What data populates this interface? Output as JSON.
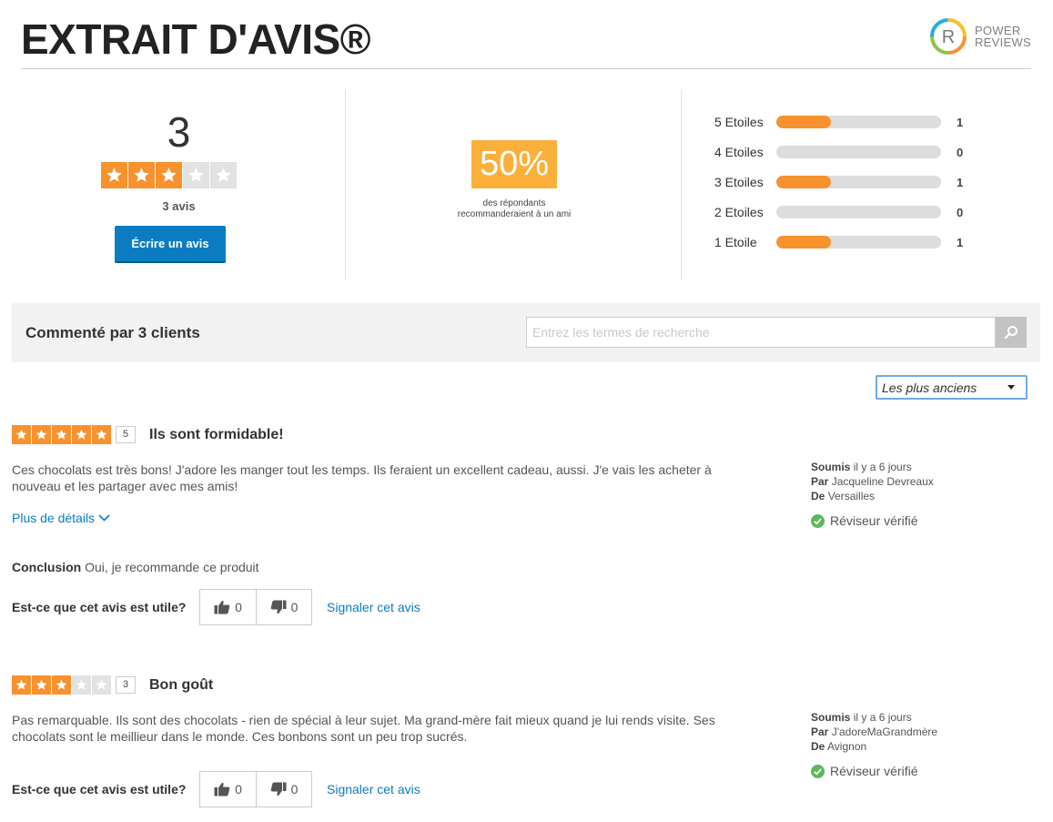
{
  "header": {
    "title": "EXTRAIT D'AVIS®",
    "logo_text_line1": "POWER",
    "logo_text_line2": "REVIEWS"
  },
  "snapshot": {
    "average_rating": "3",
    "average_stars": 3,
    "review_count": "3 avis",
    "write_button": "Écrire un avis",
    "recommend_percent": "50%",
    "recommend_text_line1": "des répondants",
    "recommend_text_line2": "recommanderaient à un ami",
    "histogram": [
      {
        "label": "5 Etoiles",
        "count": "1",
        "fraction": 0.33
      },
      {
        "label": "4 Etoiles",
        "count": "0",
        "fraction": 0
      },
      {
        "label": "3 Etoiles",
        "count": "1",
        "fraction": 0.33
      },
      {
        "label": "2 Etoiles",
        "count": "0",
        "fraction": 0
      },
      {
        "label": "1 Etoile",
        "count": "1",
        "fraction": 0.33
      }
    ]
  },
  "toolbar": {
    "title": "Commenté par 3 clients",
    "search_placeholder": "Entrez les termes de recherche",
    "sort_value": "Les plus anciens"
  },
  "reviews": [
    {
      "rating": 5,
      "rating_label": "5",
      "title": "Ils sont formidable!",
      "body_line1": "Ces chocolats est très bons! J'adore les manger tout les temps. Ils feraient un excellent cadeau, aussi. J'e vais les acheter à",
      "body_line2": "nouveau et les partager avec mes amis!",
      "details_link": "Plus de détails",
      "conclusion_label": "Conclusion",
      "conclusion_text": "Oui, je recommande ce produit",
      "helpful_question": "Est-ce que cet avis est utile?",
      "helpful_yes": "0",
      "helpful_no": "0",
      "flag_link": "Signaler cet avis",
      "submitted_label": "Soumis",
      "submitted_value": "il y a 6 jours",
      "by_label": "Par",
      "by_value": "Jacqueline Devreaux",
      "from_label": "De",
      "from_value": "Versailles",
      "verified": "Réviseur vérifié"
    },
    {
      "rating": 3,
      "rating_label": "3",
      "title": "Bon goût",
      "body_line1": "Pas remarquable. Ils sont des chocolats - rien de spécial à leur sujet. Ma grand-mère fait mieux quand je lui rends visite. Ses",
      "body_line2": "chocolats sont le meillieur dans le monde. Ces bonbons sont un peu trop sucrés.",
      "helpful_question": "Est-ce que cet avis est utile?",
      "helpful_yes": "0",
      "helpful_no": "0",
      "flag_link": "Signaler cet avis",
      "submitted_label": "Soumis",
      "submitted_value": "il y a 6 jours",
      "by_label": "Par",
      "by_value": "J'adoreMaGrandmère",
      "from_label": "De",
      "from_value": "Avignon",
      "verified": "Réviseur vérifié"
    }
  ],
  "colors": {
    "star_filled": "#f7922e",
    "star_empty": "#e2e2e2",
    "accent_blue": "#0c7cc1",
    "recommend_badge": "#fbb03b",
    "verified_green": "#5cb85c"
  }
}
